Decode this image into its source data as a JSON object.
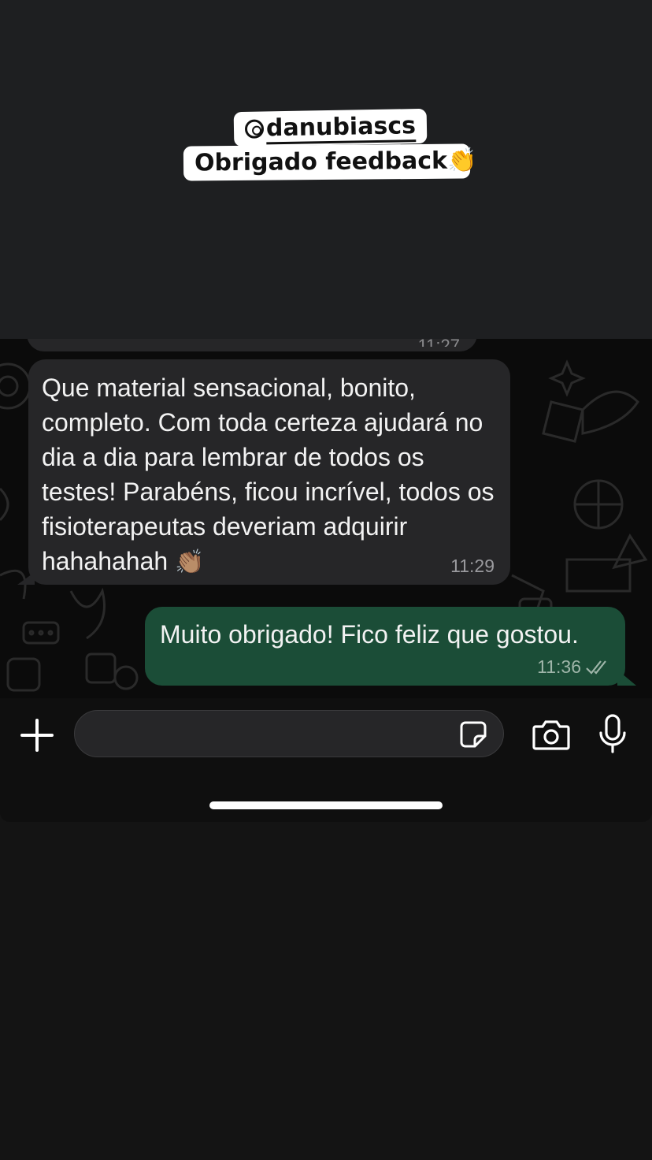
{
  "overlay": {
    "handle": "danubiascs",
    "caption": "Obrigado feedback",
    "caption_emoji": "👏"
  },
  "chat": {
    "previous_time": "11:27",
    "incoming": {
      "text": "Que material sensacional, bonito, completo. Com toda certeza ajudará no dia a dia para lembrar de todos os testes! Parabéns, ficou incrível, todos os fisioterapeutas deveriam adquirir hahahahah",
      "emoji": "👏🏽",
      "time": "11:29"
    },
    "outgoing": {
      "text": "Muito obrigado! Fico feliz que gostou.",
      "time": "11:36",
      "status_icon": "double-check-read-icon"
    }
  },
  "input": {
    "placeholder": ""
  },
  "colors": {
    "incoming_bubble": "#262628",
    "outgoing_bubble": "#1b4d37",
    "chat_background": "#0b0b0b"
  }
}
